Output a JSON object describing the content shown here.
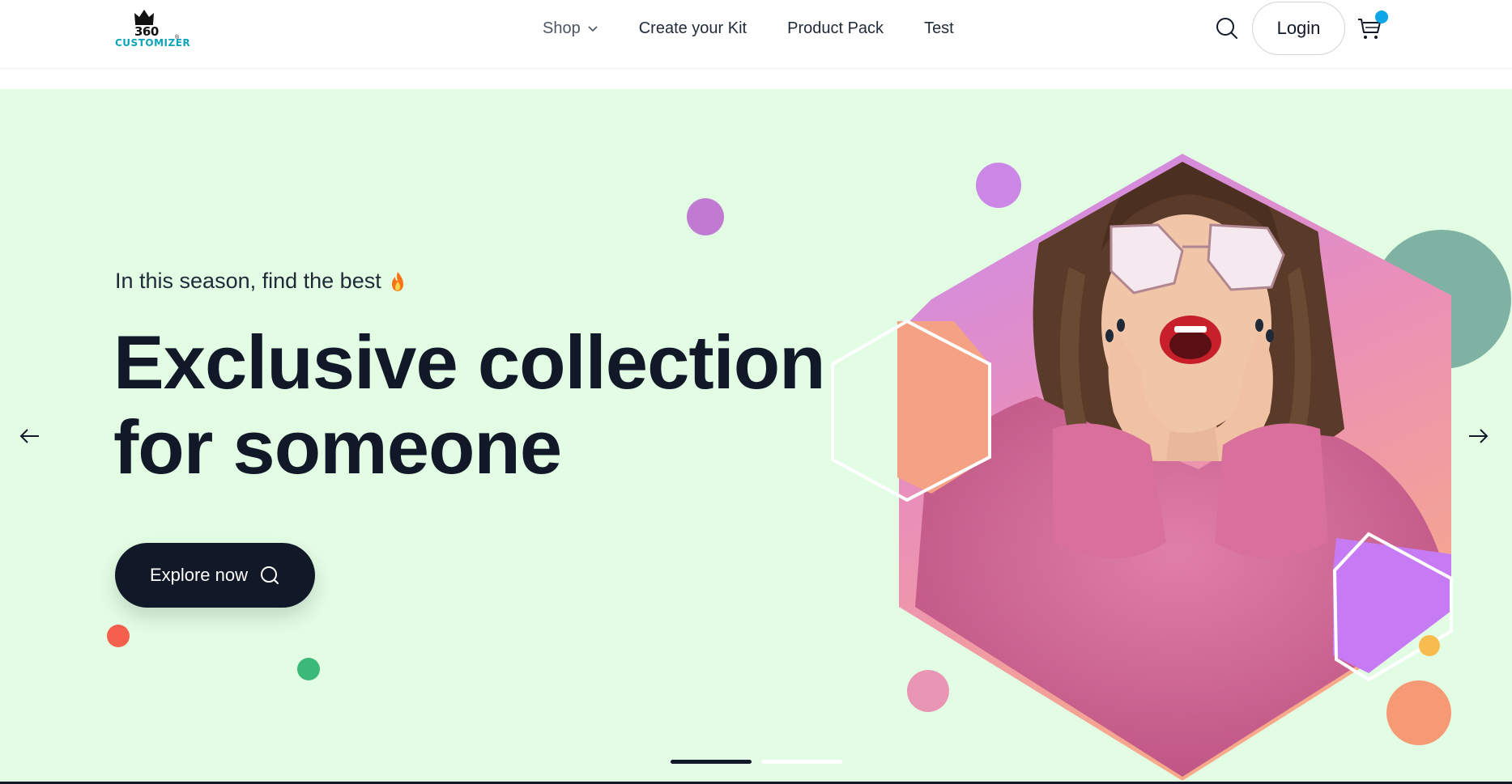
{
  "brand": {
    "logo_number": "360",
    "logo_word": "CUSTOMIZER",
    "logo_mark": "®",
    "accent": "#0aa5b8"
  },
  "nav": {
    "items": [
      {
        "label": "Shop",
        "has_dropdown": true
      },
      {
        "label": "Create your Kit"
      },
      {
        "label": "Product Pack"
      },
      {
        "label": "Test"
      }
    ]
  },
  "header_actions": {
    "search_icon": "search-icon",
    "login_label": "Login",
    "cart_icon": "cart-icon",
    "cart_badge_color": "#0ea5e9"
  },
  "hero": {
    "subtitle": "In this season, find the best",
    "subtitle_icon": "flame-icon",
    "headline_line1": "Exclusive collection",
    "headline_line2": "for someone",
    "cta_label": "Explore now",
    "cta_icon": "search-icon",
    "background": "#e3fde5",
    "image_description_icon": "woman-with-sunglasses-image"
  },
  "slider": {
    "prev_icon": "arrow-left-icon",
    "next_icon": "arrow-right-icon",
    "slides_total": 2,
    "active_slide": 1
  }
}
